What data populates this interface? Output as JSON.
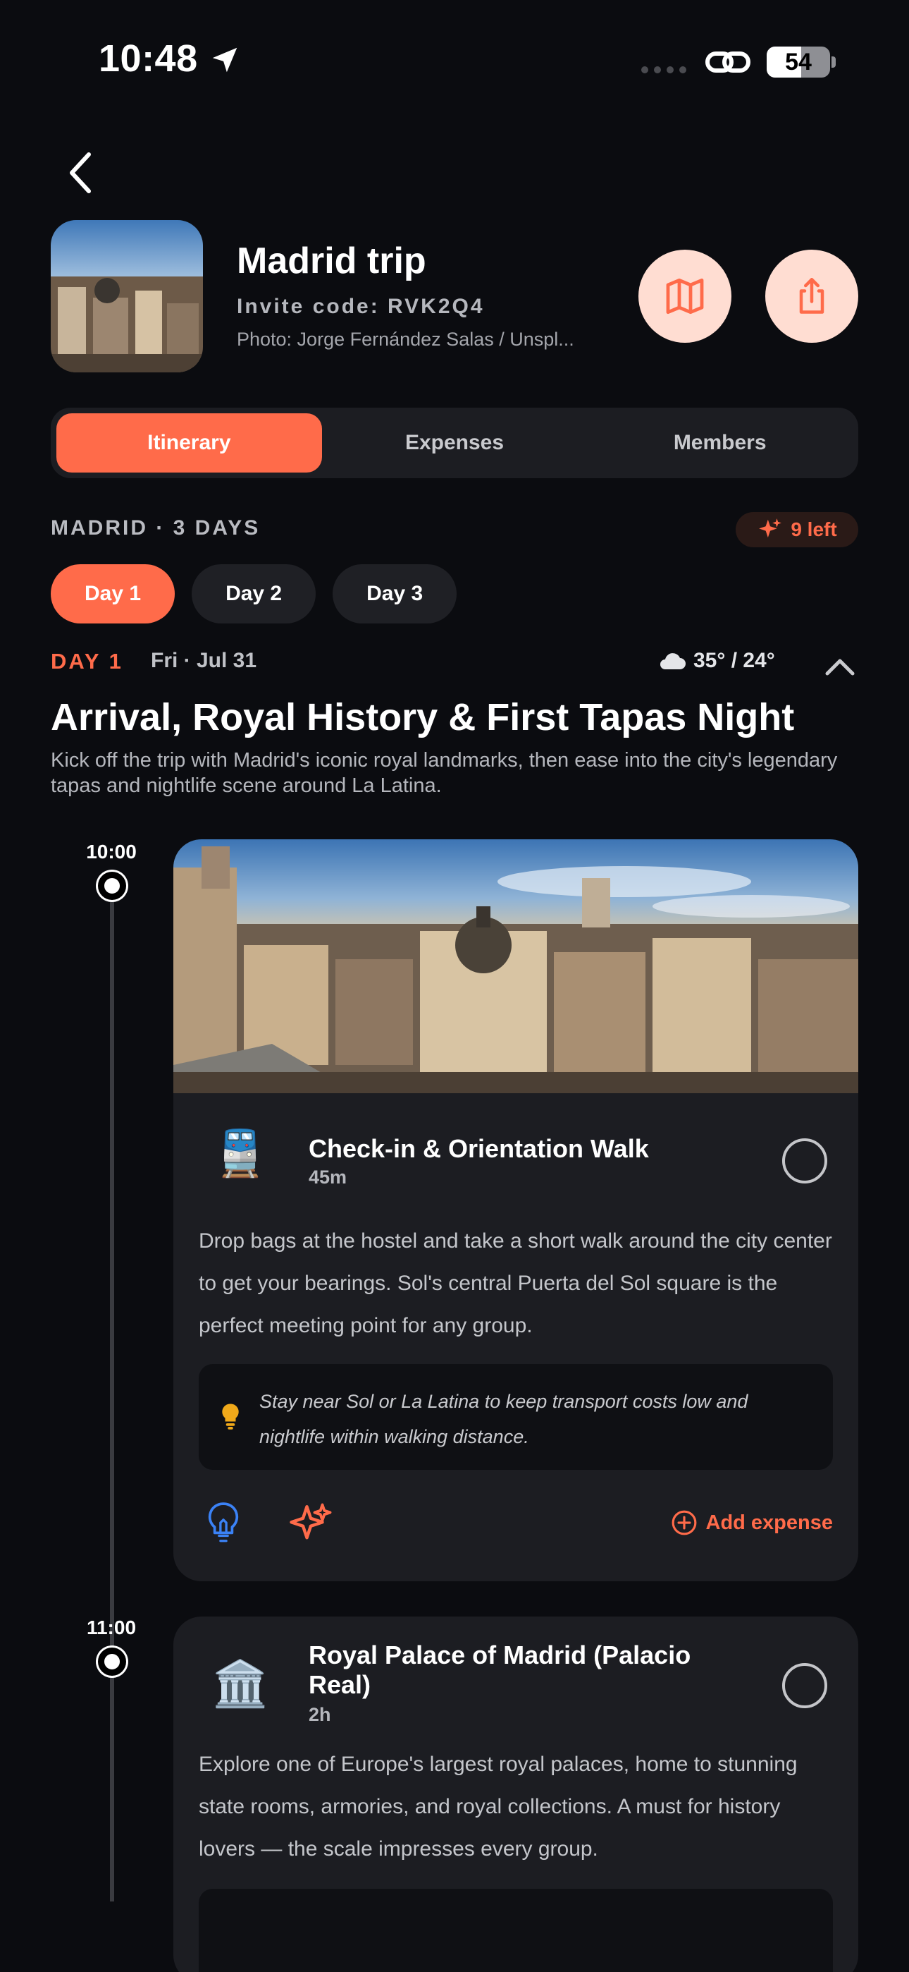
{
  "status_bar": {
    "time": "10:48",
    "battery": "54",
    "battery_percent": 54
  },
  "header": {
    "title": "Madrid trip",
    "invite_code": "Invite code: RVK2Q4",
    "photo_credit": "Photo: Jorge Fernández Salas / Unspl...",
    "map_icon": "map-icon",
    "share_icon": "share-icon"
  },
  "tabs": [
    "Itinerary",
    "Expenses",
    "Members"
  ],
  "active_tab": "Itinerary",
  "meta": {
    "location_days": "MADRID · 3 DAYS",
    "ai_left": "9 left"
  },
  "days": [
    "Day 1",
    "Day 2",
    "Day 3"
  ],
  "day": {
    "label": "DAY 1",
    "date": "Fri · Jul 31",
    "weather": "35° / 24°",
    "title": "Arrival, Royal History & First Tapas Night",
    "description": "Kick off the trip with Madrid's iconic royal landmarks, then ease into the city's legendary tapas and nightlife scene around La Latina."
  },
  "activities": [
    {
      "time": "10:00",
      "icon": "🚆",
      "name": "Check-in & Orientation Walk",
      "duration": "45m",
      "description": "Drop bags at the hostel and take a short walk around the city center to get your bearings. Sol's central Puerta del Sol square is the perfect meeting point for any group.",
      "tip": "Stay near Sol or La Latina to keep transport costs low and nightlife within walking distance.",
      "add_expense": "Add expense"
    },
    {
      "time": "11:00",
      "icon": "🏛️",
      "name": "Royal Palace of Madrid (Palacio Real)",
      "duration": "2h",
      "description": "Explore one of Europe's largest royal palaces, home to stunning state rooms, armories, and royal collections. A must for history lovers — the scale impresses every group."
    }
  ],
  "colors": {
    "accent": "#ff6b4a",
    "background": "#0b0c10",
    "card": "#1c1d22"
  }
}
